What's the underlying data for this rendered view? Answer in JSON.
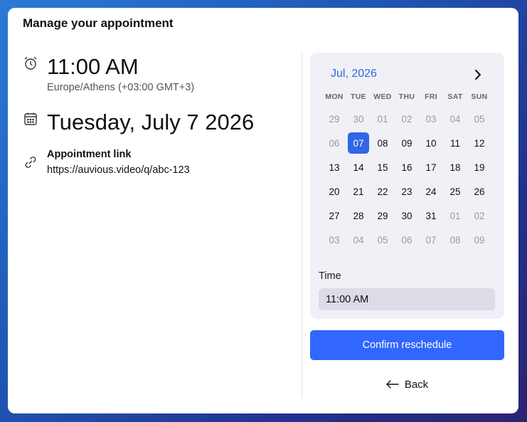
{
  "header": {
    "title": "Manage your appointment"
  },
  "details": {
    "time": "11:00 AM",
    "timezone": "Europe/Athens (+03:00 GMT+3)",
    "date": "Tuesday, July 7 2026",
    "link_label": "Appointment link",
    "link_url": "https://auvious.video/q/abc-123"
  },
  "calendar": {
    "month_label": "Jul, 2026",
    "weekdays": [
      "MON",
      "TUE",
      "WED",
      "THU",
      "FRI",
      "SAT",
      "SUN"
    ],
    "days": [
      {
        "d": "29",
        "m": true
      },
      {
        "d": "30",
        "m": true
      },
      {
        "d": "01",
        "m": true
      },
      {
        "d": "02",
        "m": true
      },
      {
        "d": "03",
        "m": true
      },
      {
        "d": "04",
        "m": true
      },
      {
        "d": "05",
        "m": true
      },
      {
        "d": "06",
        "m": true
      },
      {
        "d": "07",
        "sel": true
      },
      {
        "d": "08"
      },
      {
        "d": "09"
      },
      {
        "d": "10"
      },
      {
        "d": "11"
      },
      {
        "d": "12"
      },
      {
        "d": "13"
      },
      {
        "d": "14"
      },
      {
        "d": "15"
      },
      {
        "d": "16"
      },
      {
        "d": "17"
      },
      {
        "d": "18"
      },
      {
        "d": "19"
      },
      {
        "d": "20"
      },
      {
        "d": "21"
      },
      {
        "d": "22"
      },
      {
        "d": "23"
      },
      {
        "d": "24"
      },
      {
        "d": "25"
      },
      {
        "d": "26"
      },
      {
        "d": "27"
      },
      {
        "d": "28"
      },
      {
        "d": "29"
      },
      {
        "d": "30"
      },
      {
        "d": "31"
      },
      {
        "d": "01",
        "m": true
      },
      {
        "d": "02",
        "m": true
      },
      {
        "d": "03",
        "m": true
      },
      {
        "d": "04",
        "m": true
      },
      {
        "d": "05",
        "m": true
      },
      {
        "d": "06",
        "m": true
      },
      {
        "d": "07",
        "m": true
      },
      {
        "d": "08",
        "m": true
      },
      {
        "d": "09",
        "m": true
      }
    ],
    "time_label": "Time",
    "time_value": "11:00 AM"
  },
  "actions": {
    "confirm_label": "Confirm reschedule",
    "back_label": "Back"
  },
  "colors": {
    "accent": "#3166e5",
    "button": "#3166ff"
  }
}
